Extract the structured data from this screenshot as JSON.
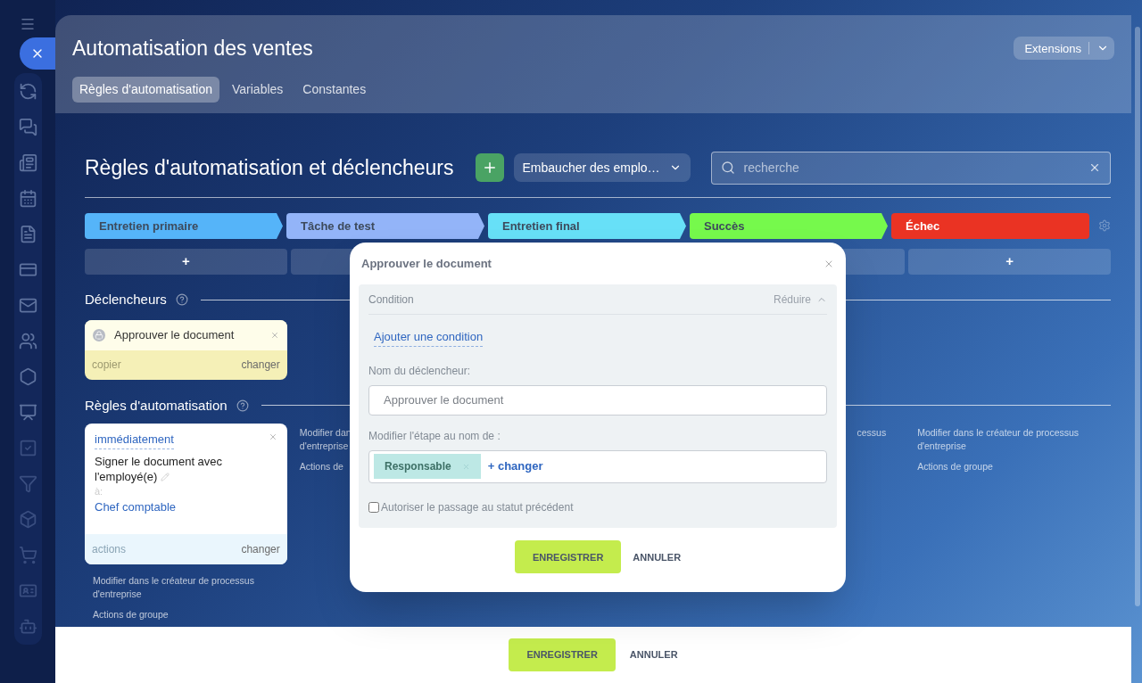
{
  "header": {
    "title": "Automatisation des ventes",
    "tabs": [
      {
        "label": "Règles d'automatisation",
        "selected": true
      },
      {
        "label": "Variables",
        "selected": false
      },
      {
        "label": "Constantes",
        "selected": false
      }
    ],
    "extensions_button": "Extensions"
  },
  "toolbar": {
    "title": "Règles d'automatisation et déclencheurs",
    "pipeline_select": "Embaucher des emplo…",
    "search": {
      "placeholder": "recherche"
    }
  },
  "stages": [
    {
      "name": "Entretien primaire",
      "color": "#55b4f9",
      "add_button": "+"
    },
    {
      "name": "Tâche de test",
      "color": "#93b4f8"
    },
    {
      "name": "Entretien final",
      "color": "#67e0f7"
    },
    {
      "name": "Succès",
      "color": "#76f94c"
    },
    {
      "name": "Échec",
      "color": "#ea3323",
      "add_button": "+"
    }
  ],
  "triggers": {
    "title": "Déclencheurs",
    "cards": [
      {
        "name": "Approuver le document",
        "copy": "copier",
        "edit": "changer"
      }
    ]
  },
  "rules": {
    "title": "Règles d'automatisation",
    "columns": [
      {
        "card": {
          "delay": "immédiatement",
          "title": "Signer le document avec l'employé(e)",
          "to_label": "à:",
          "recipient": "Chef comptable",
          "footer_left": "actions",
          "footer_right": "changer"
        },
        "links": [
          [
            "Modifier dans le créateur de processus",
            "d'entreprise"
          ],
          [
            "Actions de groupe"
          ]
        ]
      },
      {
        "links": [
          [
            "Modifier dan",
            "d'entreprise"
          ],
          [
            "Actions de"
          ]
        ]
      },
      {},
      {
        "links": [
          [
            "cessus"
          ]
        ]
      },
      {
        "links": [
          [
            "Modifier dans le créateur de processus",
            "d'entreprise"
          ],
          [
            "Actions de groupe"
          ]
        ]
      }
    ]
  },
  "dialog": {
    "title": "Approuver le document",
    "section": {
      "title": "Condition",
      "collapse": "Réduire",
      "add_condition": "Ajouter une condition"
    },
    "name_label": "Nom du déclencheur:",
    "name_value": "Approuver le document",
    "stage_label": "Modifier l'étape au nom de :",
    "stage_tag": "Responsable",
    "stage_change": "+ changer",
    "allow_back": {
      "label": "Autoriser le passage au statut précédent",
      "checked": false
    },
    "buttons": {
      "save": "ENREGISTRER",
      "cancel": "ANNULER"
    }
  },
  "footer": {
    "save": "ENREGISTRER",
    "cancel": "ANNULER"
  }
}
